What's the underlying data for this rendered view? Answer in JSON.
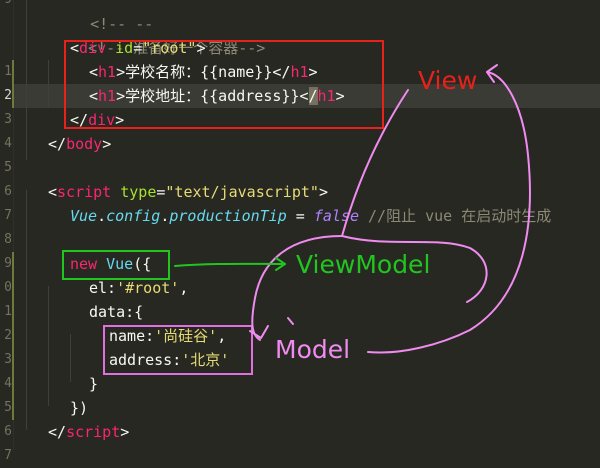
{
  "gutter": {
    "line_numbers": [
      "9",
      "1",
      "2",
      "3",
      "4",
      "5",
      "6",
      "7",
      "8",
      "9",
      "0",
      "1",
      "2",
      "3",
      "4",
      "5",
      "6",
      "7"
    ],
    "active_line_index": 4
  },
  "code_lines": {
    "l0": "<!-- --",
    "l1": "<!-- 准备好一个容器-->",
    "l2_open": "<",
    "l2_tag": "div",
    "l2_attr": " id",
    "l2_eq": "=",
    "l2_val": "\"root\"",
    "l2_close": ">",
    "l3_o1": "<",
    "l3_t1": "h1",
    "l3_c1": ">",
    "l3_text": "学校名称：{{name}}",
    "l3_o2": "</",
    "l3_t2": "h1",
    "l3_c2": ">",
    "l4_o1": "<",
    "l4_t1": "h1",
    "l4_c1": ">",
    "l4_text": "学校地址：{{address}}",
    "l4_o2": "<",
    "l4_sel": "/",
    "l4_t2": "h1",
    "l4_c2": ">",
    "l5_o": "</",
    "l5_t": "div",
    "l5_c": ">",
    "l6_o": "</",
    "l6_t": "body",
    "l6_c": ">",
    "l8_o": "<",
    "l8_t": "script",
    "l8_a": " type",
    "l8_eq": "=",
    "l8_v": "\"text/javascript\"",
    "l8_c": ">",
    "l9_vue": "Vue",
    "l9_dot1": ".",
    "l9_config": "config",
    "l9_dot2": ".",
    "l9_pt": "productionTip",
    "l9_eq": " = ",
    "l9_false": "false",
    "l9_comment": " //阻止 vue 在启动时生成",
    "l11_new": "new",
    "l11_vue": " Vue",
    "l11_rest": "({",
    "l12_el": "el:",
    "l12_val": "'#root'",
    "l12_comma": ",",
    "l13_data": "data:{",
    "l14_key": "name:",
    "l14_val": "'尚硅谷'",
    "l14_comma": ",",
    "l15_key": "address:",
    "l15_val": "'北京'",
    "l16": "}",
    "l17": "})",
    "l18_o": "</",
    "l18_t": "script",
    "l18_c": ">"
  },
  "annotations": {
    "view": "View",
    "viewmodel": "ViewModel",
    "model": "Model"
  },
  "colors": {
    "background": "#272822",
    "annotation_red": "#e8211b",
    "annotation_green": "#22c51f",
    "annotation_pink": "#f08bf0"
  }
}
